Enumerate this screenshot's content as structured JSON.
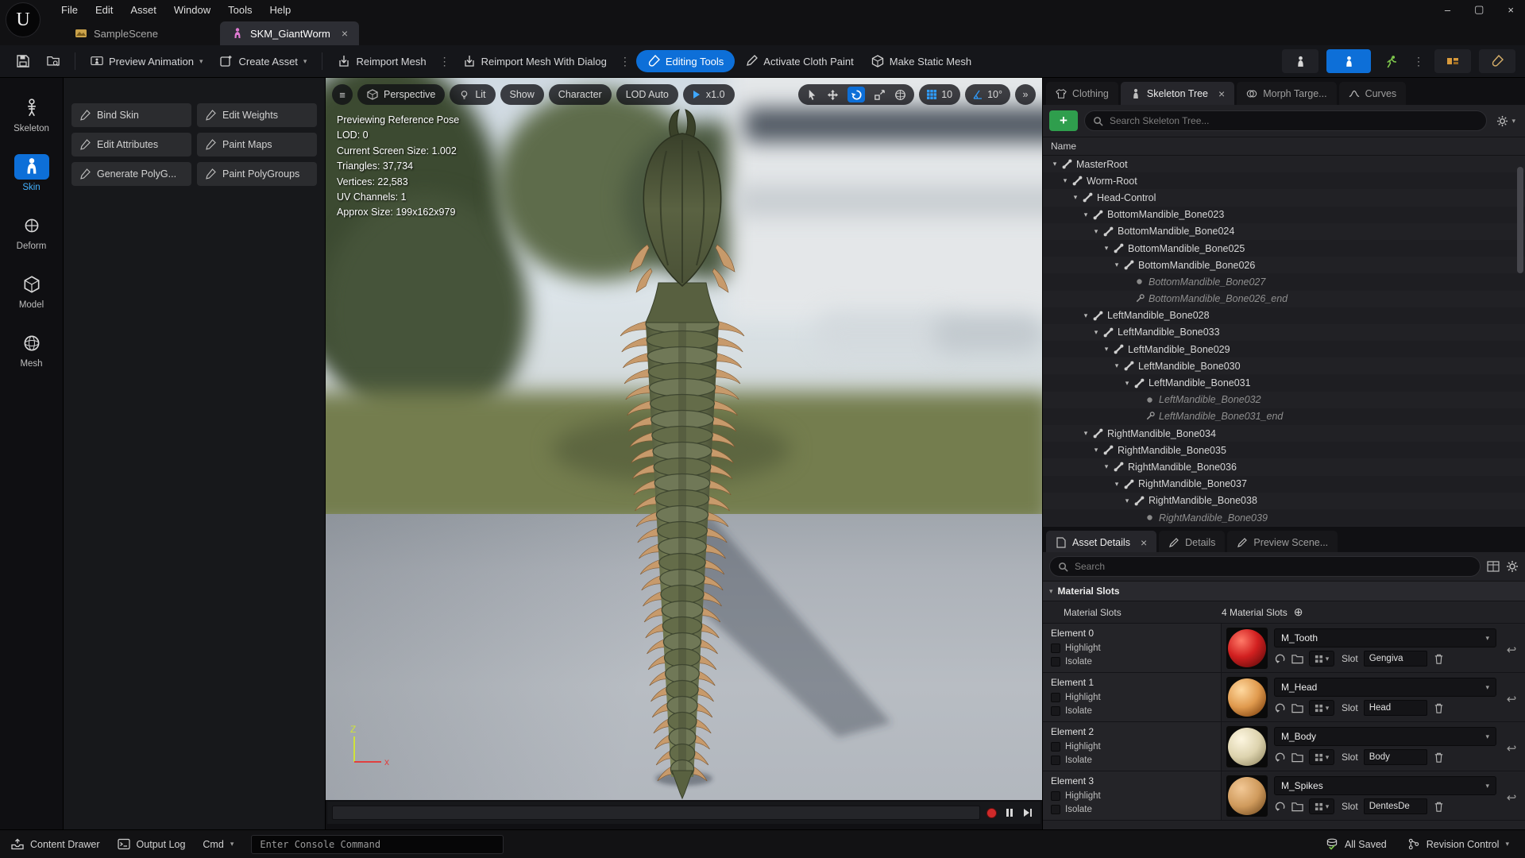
{
  "menu": {
    "items": [
      "File",
      "Edit",
      "Asset",
      "Window",
      "Tools",
      "Help"
    ]
  },
  "window_controls": {
    "minimize": "–",
    "maximize": "▢",
    "close": "×"
  },
  "tabs": [
    {
      "label": "SampleScene",
      "active": false,
      "icon": "level-icon",
      "closable": false
    },
    {
      "label": "SKM_GiantWorm",
      "active": true,
      "icon": "skeletal-mesh-icon",
      "closable": true
    }
  ],
  "toolbar": {
    "preview_animation": "Preview Animation",
    "create_asset": "Create Asset",
    "reimport_mesh": "Reimport Mesh",
    "reimport_mesh_with_dialog": "Reimport Mesh With Dialog",
    "editing_tools": "Editing Tools",
    "activate_cloth_paint": "Activate Cloth Paint",
    "make_static_mesh": "Make Static Mesh"
  },
  "left_rail": [
    {
      "label": "Skeleton",
      "active": false
    },
    {
      "label": "Skin",
      "active": true
    },
    {
      "label": "Deform",
      "active": false
    },
    {
      "label": "Model",
      "active": false
    },
    {
      "label": "Mesh",
      "active": false
    }
  ],
  "tools_panel": [
    "Bind Skin",
    "Edit Weights",
    "Edit Attributes",
    "Paint Maps",
    "Generate PolyG...",
    "Paint PolyGroups"
  ],
  "viewport": {
    "toolbar": {
      "menu": "≡",
      "perspective": "Perspective",
      "lit": "Lit",
      "show": "Show",
      "character": "Character",
      "lod": "LOD Auto",
      "speed": "x1.0",
      "grid_snap": "10",
      "angle_snap": "10°",
      "more": "»"
    },
    "stats": [
      "Previewing Reference Pose",
      "LOD: 0",
      "Current Screen Size: 1.002",
      "Triangles: 37,734",
      "Vertices: 22,583",
      "UV Channels: 1",
      "Approx Size: 199x162x979"
    ],
    "axis": {
      "up": "Z",
      "right": "x"
    }
  },
  "skeleton_panel": {
    "tabs": [
      {
        "label": "Clothing",
        "active": false
      },
      {
        "label": "Skeleton Tree",
        "active": true,
        "closable": true
      },
      {
        "label": "Morph Targe...",
        "active": false
      },
      {
        "label": "Curves",
        "active": false
      }
    ],
    "search_placeholder": "Search Skeleton Tree...",
    "column_header": "Name",
    "rows": [
      {
        "label": "MasterRoot",
        "indent": 0,
        "icon": "bone",
        "caret": true
      },
      {
        "label": "Worm-Root",
        "indent": 1,
        "icon": "bone",
        "caret": true
      },
      {
        "label": "Head-Control",
        "indent": 2,
        "icon": "bone",
        "caret": true
      },
      {
        "label": "BottomMandible_Bone023",
        "indent": 3,
        "icon": "bone",
        "caret": true
      },
      {
        "label": "BottomMandible_Bone024",
        "indent": 4,
        "icon": "bone",
        "caret": true
      },
      {
        "label": "BottomMandible_Bone025",
        "indent": 5,
        "icon": "bone",
        "caret": true
      },
      {
        "label": "BottomMandible_Bone026",
        "indent": 6,
        "icon": "bone",
        "caret": true
      },
      {
        "label": "BottomMandible_Bone027",
        "indent": 7,
        "icon": "dot",
        "dim": true
      },
      {
        "label": "BottomMandible_Bone026_end",
        "indent": 7,
        "icon": "end",
        "dim": true
      },
      {
        "label": "LeftMandible_Bone028",
        "indent": 3,
        "icon": "bone",
        "caret": true
      },
      {
        "label": "LeftMandible_Bone033",
        "indent": 4,
        "icon": "bone",
        "caret": true
      },
      {
        "label": "LeftMandible_Bone029",
        "indent": 5,
        "icon": "bone",
        "caret": true
      },
      {
        "label": "LeftMandible_Bone030",
        "indent": 6,
        "icon": "bone",
        "caret": true
      },
      {
        "label": "LeftMandible_Bone031",
        "indent": 7,
        "icon": "bone",
        "caret": true
      },
      {
        "label": "LeftMandible_Bone032",
        "indent": 8,
        "icon": "dot",
        "dim": true
      },
      {
        "label": "LeftMandible_Bone031_end",
        "indent": 8,
        "icon": "end",
        "dim": true
      },
      {
        "label": "RightMandible_Bone034",
        "indent": 3,
        "icon": "bone",
        "caret": true
      },
      {
        "label": "RightMandible_Bone035",
        "indent": 4,
        "icon": "bone",
        "caret": true
      },
      {
        "label": "RightMandible_Bone036",
        "indent": 5,
        "icon": "bone",
        "caret": true
      },
      {
        "label": "RightMandible_Bone037",
        "indent": 6,
        "icon": "bone",
        "caret": true
      },
      {
        "label": "RightMandible_Bone038",
        "indent": 7,
        "icon": "bone",
        "caret": true
      },
      {
        "label": "RightMandible_Bone039",
        "indent": 8,
        "icon": "dot",
        "dim": true
      }
    ]
  },
  "details_panel": {
    "tabs": [
      {
        "label": "Asset Details",
        "active": true,
        "closable": true
      },
      {
        "label": "Details",
        "active": false
      },
      {
        "label": "Preview Scene...",
        "active": false
      }
    ],
    "search_placeholder": "Search",
    "section_header": "Material Slots",
    "slots_label": "Material Slots",
    "slots_count": "4 Material Slots",
    "slot_label": "Slot",
    "checkbox_labels": {
      "highlight": "Highlight",
      "isolate": "Isolate"
    },
    "elements": [
      {
        "name": "Element 0",
        "material": "M_Tooth",
        "slot": "Gengiva",
        "thumb": "tooth"
      },
      {
        "name": "Element 1",
        "material": "M_Head",
        "slot": "Head",
        "thumb": "head"
      },
      {
        "name": "Element 2",
        "material": "M_Body",
        "slot": "Body",
        "thumb": "body"
      },
      {
        "name": "Element 3",
        "material": "M_Spikes",
        "slot": "DentesDe",
        "thumb": "spikes"
      }
    ]
  },
  "status_bar": {
    "content_drawer": "Content Drawer",
    "output_log": "Output Log",
    "cmd": "Cmd",
    "console_placeholder": "Enter Console Command",
    "all_saved": "All Saved",
    "revision_control": "Revision Control"
  },
  "colors": {
    "accent_blue": "#0d6fd8",
    "active_text_blue": "#44b2ff",
    "snap_blue": "#2f9dff",
    "add_green": "#2f9e4d",
    "record_red": "#d02a2a"
  }
}
